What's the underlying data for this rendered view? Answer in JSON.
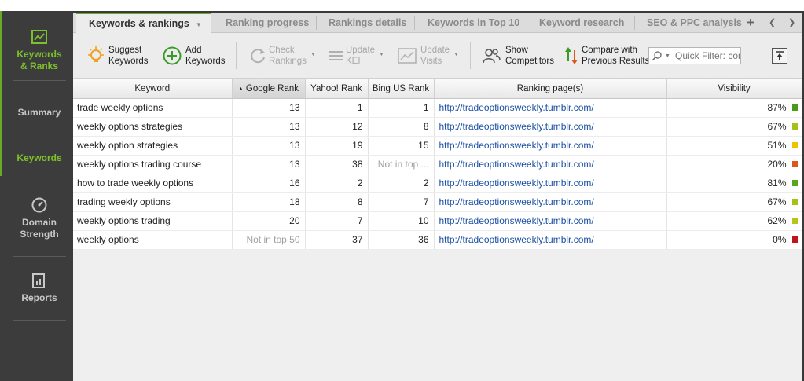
{
  "sidebar": {
    "items": [
      {
        "label_line1": "Keywords",
        "label_line2": "& Ranks",
        "icon": "chart-window-icon",
        "active": true
      },
      {
        "label": "Summary",
        "active": false
      },
      {
        "label": "Keywords",
        "active": true
      },
      {
        "label_line1": "Domain",
        "label_line2": "Strength",
        "icon": "gauge-icon",
        "active": false
      },
      {
        "label": "Reports",
        "icon": "report-icon",
        "active": false
      }
    ]
  },
  "tabs": [
    {
      "label": "Keywords & rankings",
      "active": true
    },
    {
      "label": "Ranking progress"
    },
    {
      "label": "Rankings details"
    },
    {
      "label": "Keywords in Top 10"
    },
    {
      "label": "Keyword research"
    },
    {
      "label": "SEO & PPC analysis"
    }
  ],
  "tab_controls": {
    "add": "+",
    "prev": "❮",
    "next": "❯"
  },
  "toolbar": {
    "suggest": {
      "line1": "Suggest",
      "line2": "Keywords"
    },
    "add": {
      "line1": "Add",
      "line2": "Keywords"
    },
    "check": {
      "line1": "Check",
      "line2": "Rankings"
    },
    "update_kei": {
      "line1": "Update",
      "line2": "KEI"
    },
    "update_visits": {
      "line1": "Update",
      "line2": "Visits"
    },
    "competitors": {
      "line1": "Show",
      "line2": "Competitors"
    },
    "compare": {
      "line1": "Compare with",
      "line2": "Previous Results"
    },
    "filter_placeholder": "Quick Filter: contains"
  },
  "table": {
    "columns": [
      "Keyword",
      "Google Rank",
      "Yahoo! Rank",
      "Bing US Rank",
      "Ranking page(s)",
      "Visibility"
    ],
    "sort_indicator": "▲",
    "rows": [
      {
        "keyword": "trade weekly options",
        "google": "13",
        "yahoo": "1",
        "bing": "1",
        "page": "http://tradeoptionsweekly.tumblr.com/",
        "visibility": "87%",
        "vis_color": "#4a9a1e"
      },
      {
        "keyword": "weekly options strategies",
        "google": "13",
        "yahoo": "12",
        "bing": "8",
        "page": "http://tradeoptionsweekly.tumblr.com/",
        "visibility": "67%",
        "vis_color": "#a6c21a"
      },
      {
        "keyword": "weekly option strategies",
        "google": "13",
        "yahoo": "19",
        "bing": "15",
        "page": "http://tradeoptionsweekly.tumblr.com/",
        "visibility": "51%",
        "vis_color": "#f2c200"
      },
      {
        "keyword": "weekly options trading course",
        "google": "13",
        "yahoo": "38",
        "bing": "Not in top ...",
        "page": "http://tradeoptionsweekly.tumblr.com/",
        "visibility": "20%",
        "vis_color": "#d9581a"
      },
      {
        "keyword": "how to trade weekly options",
        "google": "16",
        "yahoo": "2",
        "bing": "2",
        "page": "http://tradeoptionsweekly.tumblr.com/",
        "visibility": "81%",
        "vis_color": "#5aa51e"
      },
      {
        "keyword": "trading weekly options",
        "google": "18",
        "yahoo": "8",
        "bing": "7",
        "page": "http://tradeoptionsweekly.tumblr.com/",
        "visibility": "67%",
        "vis_color": "#a6c21a"
      },
      {
        "keyword": "weekly options trading",
        "google": "20",
        "yahoo": "7",
        "bing": "10",
        "page": "http://tradeoptionsweekly.tumblr.com/",
        "visibility": "62%",
        "vis_color": "#b8c416"
      },
      {
        "keyword": "weekly options",
        "google": "Not in top 50",
        "yahoo": "37",
        "bing": "36",
        "page": "http://tradeoptionsweekly.tumblr.com/",
        "visibility": "0%",
        "vis_color": "#c0141a"
      }
    ]
  }
}
